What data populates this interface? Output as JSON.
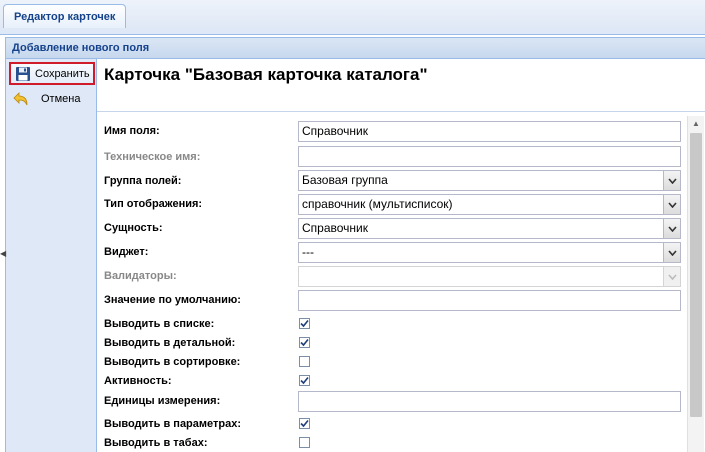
{
  "tab": {
    "label": "Редактор карточек"
  },
  "panel": {
    "title": "Добавление нового поля"
  },
  "toolbar": {
    "save_label": "Сохранить",
    "cancel_label": "Отмена"
  },
  "card": {
    "title": "Карточка \"Базовая карточка каталога\""
  },
  "fields": {
    "name": {
      "label": "Имя поля:",
      "value": "Справочник"
    },
    "tech_name": {
      "label": "Техническое имя:",
      "value": ""
    },
    "group": {
      "label": "Группа полей:",
      "value": "Базовая группа"
    },
    "display_type": {
      "label": "Тип отображения:",
      "value": "справочник (мультисписок)"
    },
    "entity": {
      "label": "Сущность:",
      "value": "Справочник"
    },
    "widget": {
      "label": "Виджет:",
      "value": "---"
    },
    "validators": {
      "label": "Валидаторы:",
      "value": ""
    },
    "default_value": {
      "label": "Значение по умолчанию:",
      "value": ""
    },
    "show_in_list": {
      "label": "Выводить в списке:",
      "checked": true
    },
    "show_in_detail": {
      "label": "Выводить в детальной:",
      "checked": true
    },
    "show_in_sort": {
      "label": "Выводить в сортировке:",
      "checked": false
    },
    "active": {
      "label": "Активность:",
      "checked": true
    },
    "units": {
      "label": "Единицы измерения:",
      "value": ""
    },
    "show_in_params": {
      "label": "Выводить в параметрах:",
      "checked": true
    },
    "show_in_tabs": {
      "label": "Выводить в табах:",
      "checked": false
    }
  },
  "colors": {
    "accent": "#15428b",
    "highlight_border": "#d01c2a",
    "panel_bg": "#dfe8f6"
  }
}
